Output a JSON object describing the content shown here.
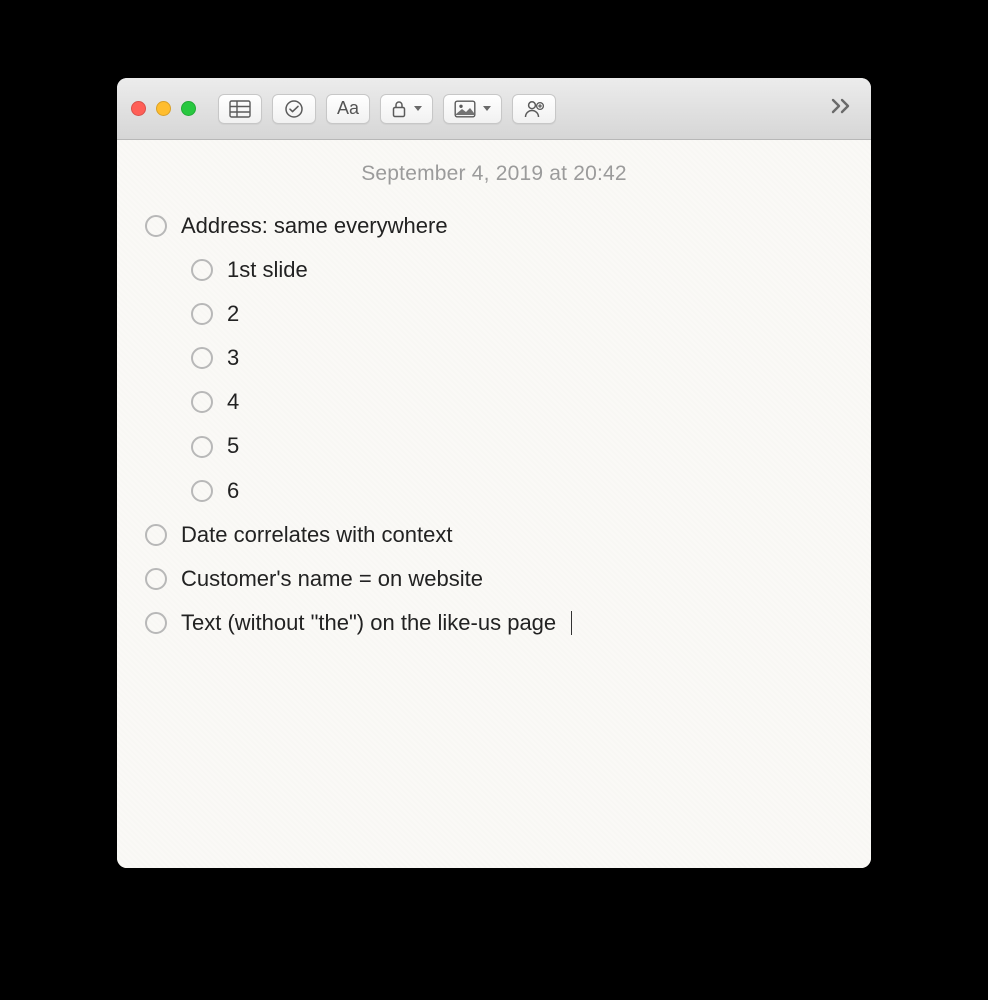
{
  "toolbar": {
    "traffic_lights": [
      "close",
      "minimize",
      "zoom"
    ],
    "buttons": {
      "table": "table-icon",
      "checklist": "checklist-icon",
      "format": "Aa",
      "lock": "lock-icon",
      "media": "media-icon",
      "share": "share-add-person-icon",
      "overflow": "overflow-icon"
    }
  },
  "note": {
    "timestamp": "September 4, 2019 at 20:42",
    "checklist": [
      {
        "text": "Address: same everywhere",
        "indent": 0,
        "checked": false
      },
      {
        "text": "1st slide",
        "indent": 1,
        "checked": false
      },
      {
        "text": "2",
        "indent": 1,
        "checked": false
      },
      {
        "text": "3",
        "indent": 1,
        "checked": false
      },
      {
        "text": "4",
        "indent": 1,
        "checked": false
      },
      {
        "text": "5",
        "indent": 1,
        "checked": false
      },
      {
        "text": "6",
        "indent": 1,
        "checked": false
      },
      {
        "text": "Date correlates with context",
        "indent": 0,
        "checked": false
      },
      {
        "text": "Customer's name = on website",
        "indent": 0,
        "checked": false
      },
      {
        "text": "Text (without \"the\") on the like-us page",
        "indent": 0,
        "checked": false,
        "caret": true
      }
    ]
  }
}
